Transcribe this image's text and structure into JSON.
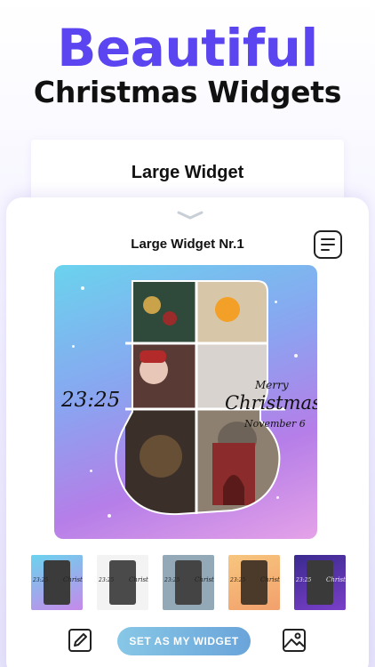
{
  "header": {
    "title_line1": "Beautiful",
    "title_line2": "Christmas Widgets"
  },
  "background_card": {
    "title": "Large Widget"
  },
  "sheet": {
    "title": "Large Widget Nr.1",
    "icons": {
      "grab_handle": "chevron-down-icon",
      "list": "list-icon"
    }
  },
  "widget_preview": {
    "time": "23:25",
    "greeting_small": "Merry",
    "greeting_large": "Christmas",
    "date": "November 6"
  },
  "thumbnails": [
    {
      "label_time": "23:25",
      "label_text": "Christmas",
      "bg": "linear-gradient(160deg,#6ad3ee,#c689ea)"
    },
    {
      "label_time": "23:25",
      "label_text": "Christmas",
      "bg": "#f3f3f3"
    },
    {
      "label_time": "23:25",
      "label_text": "Christmas",
      "bg": "#93a9b8"
    },
    {
      "label_time": "23:25",
      "label_text": "Christmas",
      "bg": "linear-gradient(160deg,#f7c67e,#f2a06c)"
    },
    {
      "label_time": "23:25",
      "label_text": "Christmas",
      "bg": "linear-gradient(160deg,#3a2a8f,#7a3fc8)"
    }
  ],
  "actions": {
    "set_widget_label": "SET AS MY WIDGET",
    "edit_icon": "pencil-icon",
    "gallery_icon": "image-icon"
  },
  "colors": {
    "accent": "#5a45f0",
    "button_start": "#87c7e6",
    "button_end": "#6aa4da"
  }
}
